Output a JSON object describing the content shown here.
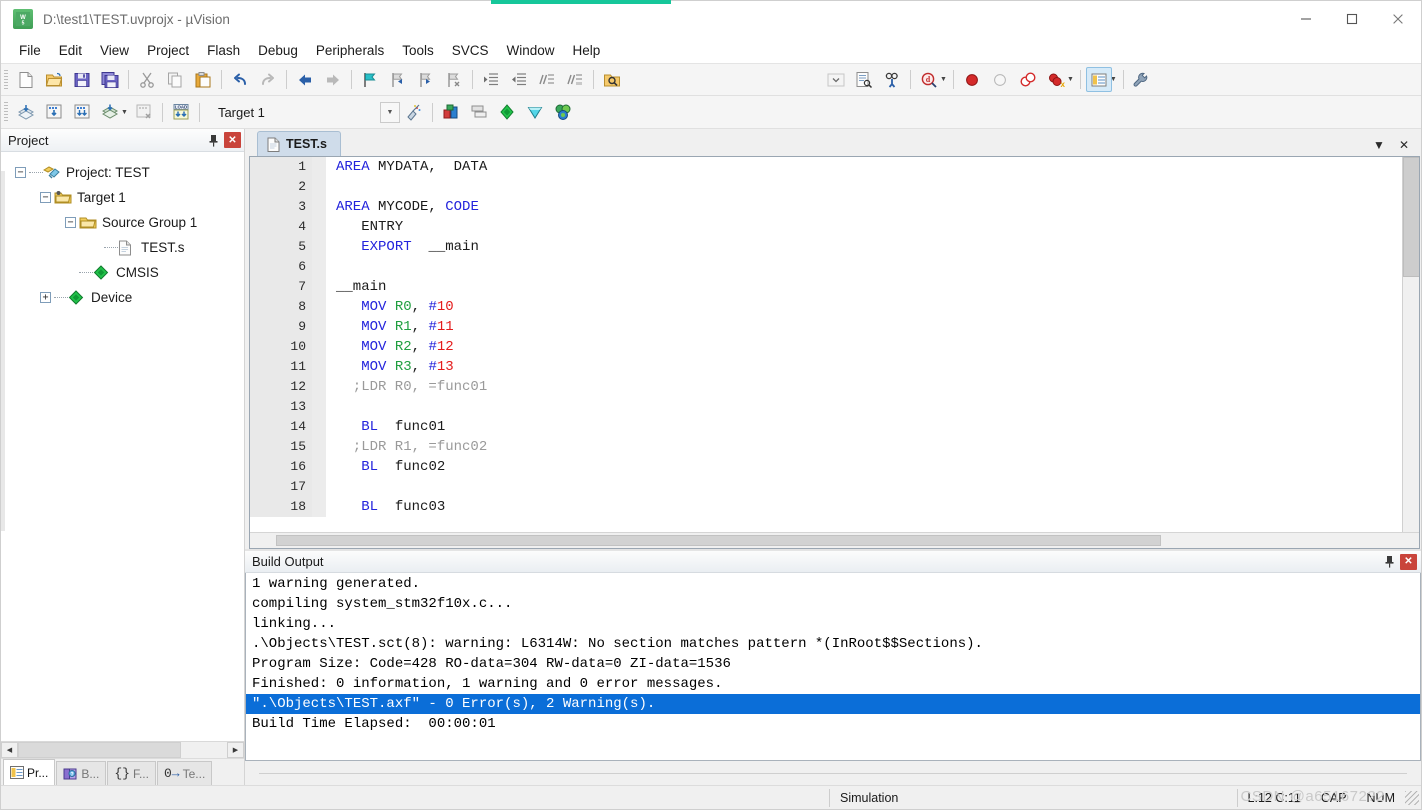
{
  "window": {
    "title": "D:\\test1\\TEST.uvprojx - µVision",
    "app_icon": "keil-uvision-icon",
    "minimize": "─",
    "maximize": "☐",
    "close": "✕"
  },
  "menubar": {
    "items": [
      {
        "label": "File"
      },
      {
        "label": "Edit"
      },
      {
        "label": "View"
      },
      {
        "label": "Project"
      },
      {
        "label": "Flash"
      },
      {
        "label": "Debug"
      },
      {
        "label": "Peripherals"
      },
      {
        "label": "Tools"
      },
      {
        "label": "SVCS"
      },
      {
        "label": "Window"
      },
      {
        "label": "Help"
      }
    ]
  },
  "toolbar_main": {
    "buttons": [
      {
        "name": "new-file-icon",
        "tip": "New"
      },
      {
        "name": "open-file-icon",
        "tip": "Open"
      },
      {
        "name": "save-icon",
        "tip": "Save"
      },
      {
        "name": "save-all-icon",
        "tip": "Save All"
      },
      {
        "name": "cut-icon",
        "tip": "Cut"
      },
      {
        "name": "copy-icon",
        "tip": "Copy"
      },
      {
        "name": "paste-icon",
        "tip": "Paste"
      },
      {
        "name": "undo-icon",
        "tip": "Undo"
      },
      {
        "name": "redo-icon",
        "tip": "Redo"
      },
      {
        "name": "navigate-back-icon",
        "tip": "Back"
      },
      {
        "name": "navigate-forward-icon",
        "tip": "Forward"
      },
      {
        "name": "bookmark-toggle-icon",
        "tip": "Insert/Remove Bookmark"
      },
      {
        "name": "bookmark-prev-icon",
        "tip": "Previous Bookmark"
      },
      {
        "name": "bookmark-next-icon",
        "tip": "Next Bookmark"
      },
      {
        "name": "bookmark-clear-icon",
        "tip": "Clear All Bookmarks"
      },
      {
        "name": "indent-icon",
        "tip": "Indent"
      },
      {
        "name": "outdent-icon",
        "tip": "Outdent"
      },
      {
        "name": "comment-icon",
        "tip": "Comment"
      },
      {
        "name": "uncomment-icon",
        "tip": "Uncomment"
      },
      {
        "name": "find-in-files-icon",
        "tip": "Find in Files"
      }
    ]
  },
  "toolbar_debug": {
    "buttons": [
      {
        "name": "dropdown-empty-icon"
      },
      {
        "name": "configure-icon"
      },
      {
        "name": "debug-start-icon"
      },
      {
        "name": "find-icon"
      },
      {
        "name": "breakpoint-insert-icon"
      },
      {
        "name": "breakpoint-disable-icon"
      },
      {
        "name": "breakpoint-disable-all-icon"
      },
      {
        "name": "breakpoint-kill-all-icon"
      },
      {
        "name": "manage-windows-icon"
      },
      {
        "name": "configure-target-icon"
      }
    ]
  },
  "toolbar_build": {
    "buttons": [
      {
        "name": "translate-icon",
        "tip": "Translate"
      },
      {
        "name": "build-icon",
        "tip": "Build"
      },
      {
        "name": "rebuild-icon",
        "tip": "Rebuild"
      },
      {
        "name": "batch-build-icon",
        "tip": "Batch Build"
      },
      {
        "name": "stop-build-icon",
        "tip": "Stop Build"
      },
      {
        "name": "download-icon",
        "tip": "Download"
      }
    ],
    "target_value": "Target 1",
    "after_buttons": [
      {
        "name": "target-options-icon"
      },
      {
        "name": "manage-project-items-icon"
      },
      {
        "name": "multi-project-icon"
      },
      {
        "name": "pack-installer-icon"
      },
      {
        "name": "manage-run-time-env-icon"
      },
      {
        "name": "select-software-packs-icon"
      }
    ]
  },
  "project_panel": {
    "title": "Project",
    "pin_icon": "pin-icon",
    "close_icon": "close-icon",
    "tree": [
      {
        "label": "Project: TEST",
        "indent": 0,
        "expander": "-",
        "icon": "project-icon"
      },
      {
        "label": "Target 1",
        "indent": 1,
        "expander": "-",
        "icon": "target-folder-icon"
      },
      {
        "label": "Source Group 1",
        "indent": 2,
        "expander": "-",
        "icon": "folder-icon"
      },
      {
        "label": "TEST.s",
        "indent": 3,
        "expander": "",
        "icon": "file-icon"
      },
      {
        "label": "CMSIS",
        "indent": 2,
        "expander": "",
        "icon": "component-icon"
      },
      {
        "label": "Device",
        "indent": 2,
        "expander": "+",
        "icon": "component-icon"
      }
    ],
    "tabs": [
      {
        "label": "Pr...",
        "icon": "project-tab-icon",
        "active": true
      },
      {
        "label": "B...",
        "icon": "books-tab-icon",
        "active": false
      },
      {
        "label": "F...",
        "icon": "functions-tab-icon",
        "active": false
      },
      {
        "label": "Te...",
        "icon": "templates-tab-icon",
        "active": false
      }
    ]
  },
  "editor": {
    "tab": {
      "label": "TEST.s",
      "icon": "file-icon"
    },
    "tab_dropdown_icon": "chevron-down-icon",
    "tab_close_icon": "close-icon",
    "lines": [
      {
        "n": "1",
        "segments": [
          {
            "t": "  ",
            "c": ""
          },
          {
            "t": "AREA",
            "c": "k"
          },
          {
            "t": " MYDATA,  DATA",
            "c": ""
          }
        ]
      },
      {
        "n": "2",
        "segments": []
      },
      {
        "n": "3",
        "segments": [
          {
            "t": "  ",
            "c": ""
          },
          {
            "t": "AREA",
            "c": "k"
          },
          {
            "t": " MYCODE, ",
            "c": ""
          },
          {
            "t": "CODE",
            "c": "k"
          }
        ]
      },
      {
        "n": "4",
        "segments": [
          {
            "t": "     ENTRY",
            "c": ""
          }
        ]
      },
      {
        "n": "5",
        "segments": [
          {
            "t": "     ",
            "c": ""
          },
          {
            "t": "EXPORT",
            "c": "k"
          },
          {
            "t": "  __main",
            "c": ""
          }
        ]
      },
      {
        "n": "6",
        "segments": []
      },
      {
        "n": "7",
        "segments": [
          {
            "t": " __main",
            "c": ""
          }
        ]
      },
      {
        "n": "8",
        "segments": [
          {
            "t": "     ",
            "c": ""
          },
          {
            "t": "MOV",
            "c": "k"
          },
          {
            "t": " ",
            "c": ""
          },
          {
            "t": "R0",
            "c": "reg"
          },
          {
            "t": ", ",
            "c": ""
          },
          {
            "t": "#",
            "c": "hash"
          },
          {
            "t": "10",
            "c": "num"
          }
        ]
      },
      {
        "n": "9",
        "segments": [
          {
            "t": "     ",
            "c": ""
          },
          {
            "t": "MOV",
            "c": "k"
          },
          {
            "t": " ",
            "c": ""
          },
          {
            "t": "R1",
            "c": "reg"
          },
          {
            "t": ", ",
            "c": ""
          },
          {
            "t": "#",
            "c": "hash"
          },
          {
            "t": "11",
            "c": "num"
          }
        ]
      },
      {
        "n": "10",
        "segments": [
          {
            "t": "     ",
            "c": ""
          },
          {
            "t": "MOV",
            "c": "k"
          },
          {
            "t": " ",
            "c": ""
          },
          {
            "t": "R2",
            "c": "reg"
          },
          {
            "t": ", ",
            "c": ""
          },
          {
            "t": "#",
            "c": "hash"
          },
          {
            "t": "12",
            "c": "num"
          }
        ]
      },
      {
        "n": "11",
        "segments": [
          {
            "t": "     ",
            "c": ""
          },
          {
            "t": "MOV",
            "c": "k"
          },
          {
            "t": " ",
            "c": ""
          },
          {
            "t": "R3",
            "c": "reg"
          },
          {
            "t": ", ",
            "c": ""
          },
          {
            "t": "#",
            "c": "hash"
          },
          {
            "t": "13",
            "c": "num"
          }
        ]
      },
      {
        "n": "12",
        "segments": [
          {
            "t": "     ;LDR R0, =func01",
            "c": "cmt"
          }
        ]
      },
      {
        "n": "13",
        "segments": []
      },
      {
        "n": "14",
        "segments": [
          {
            "t": "     ",
            "c": ""
          },
          {
            "t": "BL",
            "c": "k"
          },
          {
            "t": "  func01",
            "c": ""
          }
        ]
      },
      {
        "n": "15",
        "segments": [
          {
            "t": "     ;LDR R1, =func02",
            "c": "cmt"
          }
        ]
      },
      {
        "n": "16",
        "segments": [
          {
            "t": "     ",
            "c": ""
          },
          {
            "t": "BL",
            "c": "k"
          },
          {
            "t": "  func02",
            "c": ""
          }
        ]
      },
      {
        "n": "17",
        "segments": []
      },
      {
        "n": "18",
        "segments": [
          {
            "t": "     ",
            "c": ""
          },
          {
            "t": "BL",
            "c": "k"
          },
          {
            "t": "  func03",
            "c": ""
          }
        ]
      }
    ]
  },
  "build_output": {
    "title": "Build Output",
    "pin_icon": "pin-icon",
    "close_icon": "close-icon",
    "lines": [
      {
        "text": "1 warning generated.",
        "selected": false
      },
      {
        "text": "compiling system_stm32f10x.c...",
        "selected": false
      },
      {
        "text": "linking...",
        "selected": false
      },
      {
        "text": ".\\Objects\\TEST.sct(8): warning: L6314W: No section matches pattern *(InRoot$$Sections).",
        "selected": false
      },
      {
        "text": "Program Size: Code=428 RO-data=304 RW-data=0 ZI-data=1536",
        "selected": false
      },
      {
        "text": "Finished: 0 information, 1 warning and 0 error messages.",
        "selected": false
      },
      {
        "text": "\".\\Objects\\TEST.axf\" - 0 Error(s), 2 Warning(s).",
        "selected": true
      },
      {
        "text": "Build Time Elapsed:  00:00:01",
        "selected": false
      }
    ]
  },
  "statusbar": {
    "simulation": "Simulation",
    "cursor": "L:12 C:11",
    "caps": "CAP",
    "num": "NUM",
    "watermark": "CSDN @a651672?2"
  },
  "colors": {
    "keyword": "#2323dc",
    "register": "#1f9e3f",
    "number": "#e41b1b",
    "comment": "#9a9a9a",
    "selection": "#0b6ed8",
    "accent": "#16c79a",
    "tab_active": "#cfdcea"
  }
}
